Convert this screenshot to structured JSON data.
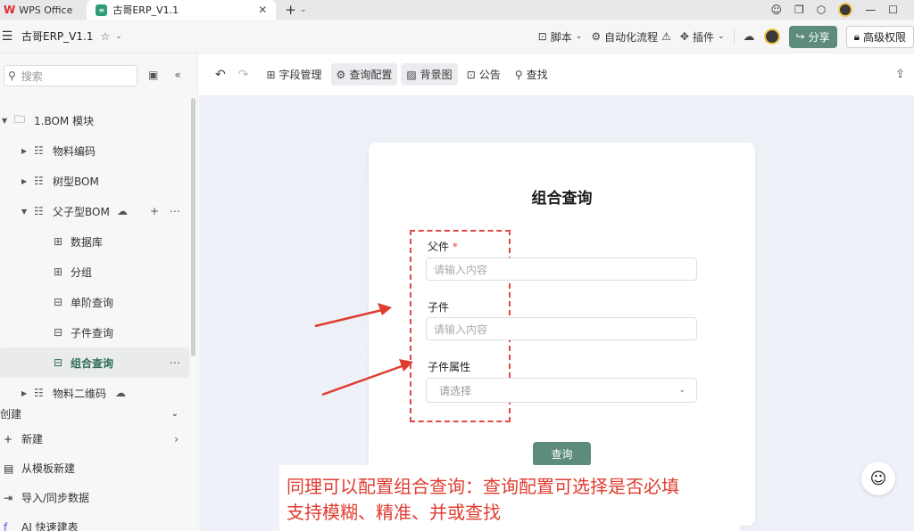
{
  "titlebar": {
    "app_tab": "WPS Office",
    "doc_tab": "古哥ERP_V1.1",
    "close": "✕",
    "add": "+"
  },
  "docbar": {
    "title": "古哥ERP_V1.1",
    "script": "脚本",
    "automation": "自动化流程",
    "plugin": "插件",
    "share": "分享",
    "permission": "高级权限"
  },
  "sidebar": {
    "search_placeholder": "搜索",
    "tree": [
      {
        "label": "1.BOM 模块"
      },
      {
        "label": "物料编码"
      },
      {
        "label": "树型BOM"
      },
      {
        "label": "父子型BOM"
      },
      {
        "label": "数据库"
      },
      {
        "label": "分组"
      },
      {
        "label": "单阶查询"
      },
      {
        "label": "子件查询"
      },
      {
        "label": "组合查询"
      },
      {
        "label": "物料二维码"
      }
    ],
    "create": {
      "heading": "创建",
      "items": [
        "新建",
        "从模板新建",
        "导入/同步数据",
        "AI 快速建表"
      ]
    }
  },
  "toolbar": {
    "field_mgmt": "字段管理",
    "query_config": "查询配置",
    "background": "背景图",
    "announcement": "公告",
    "find": "查找"
  },
  "form": {
    "title": "组合查询",
    "field1_label": "父件",
    "required_mark": "*",
    "field1_placeholder": "请输入内容",
    "field2_label": "子件",
    "field2_placeholder": "请输入内容",
    "field3_label": "子件属性",
    "field3_placeholder": "请选择",
    "submit": "查询"
  },
  "annotation": {
    "line1": "同理可以配置组合查询：查询配置可选择是否必填",
    "line2": "支持模糊、精准、并或查找"
  },
  "colors": {
    "accent": "#5d8c7d",
    "annotation": "#e03c2f"
  }
}
